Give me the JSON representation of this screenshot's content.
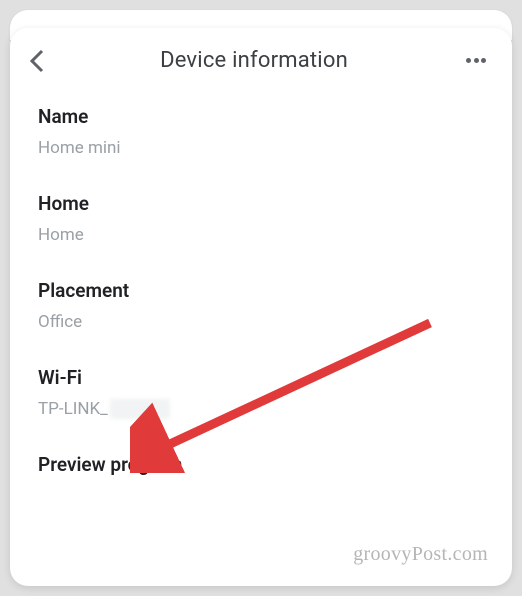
{
  "header": {
    "title": "Device information"
  },
  "sections": {
    "name": {
      "label": "Name",
      "value": "Home mini"
    },
    "home": {
      "label": "Home",
      "value": "Home"
    },
    "placement": {
      "label": "Placement",
      "value": "Office"
    },
    "wifi": {
      "label": "Wi-Fi",
      "value_prefix": "TP-LINK_"
    },
    "preview": {
      "label": "Preview program"
    }
  },
  "watermark": "groovyPost.com"
}
